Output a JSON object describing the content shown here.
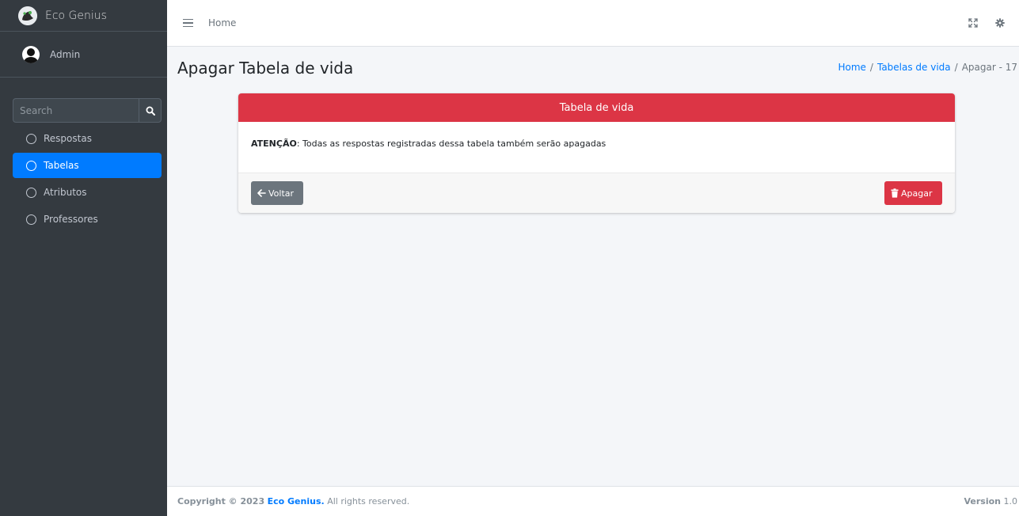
{
  "brand": {
    "name": "Eco Genius"
  },
  "user": {
    "name": "Admin"
  },
  "search": {
    "placeholder": "Search"
  },
  "sidebar": {
    "items": [
      {
        "label": "Respostas",
        "active": false
      },
      {
        "label": "Tabelas",
        "active": true
      },
      {
        "label": "Atributos",
        "active": false
      },
      {
        "label": "Professores",
        "active": false
      }
    ]
  },
  "topbar": {
    "home_label": "Home"
  },
  "page": {
    "title": "Apagar Tabela de vida"
  },
  "breadcrumb": [
    {
      "label": "Home",
      "link": true
    },
    {
      "label": "/",
      "link": false
    },
    {
      "label": "Tabelas de vida",
      "link": true
    },
    {
      "label": "/",
      "link": false
    },
    {
      "label": "Apagar - 17",
      "link": false
    }
  ],
  "card": {
    "header": "Tabela de vida",
    "warning_label": "ATENÇÃO",
    "warning_text": ": Todas as respostas registradas dessa tabela também serão apagadas",
    "back_label": "Voltar",
    "delete_label": "Apagar"
  },
  "footer": {
    "copyright_prefix": "Copyright © 2023",
    "brand": "Eco Genius.",
    "rights": "All rights reserved.",
    "version_label": "Version",
    "version_value": "1.0"
  },
  "colors": {
    "primary": "#007bff",
    "danger": "#dc3545",
    "sidebar_bg": "#343a40",
    "secondary": "#6c757d"
  }
}
